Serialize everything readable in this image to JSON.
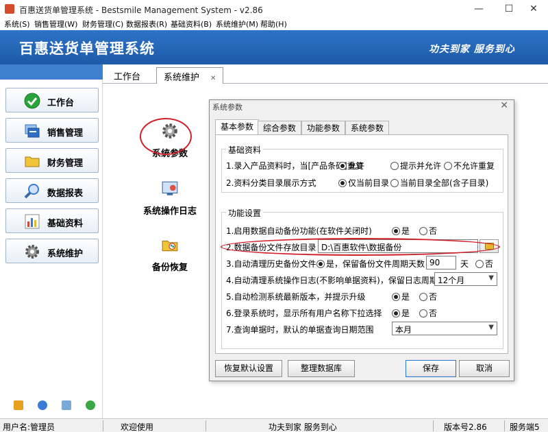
{
  "window": {
    "title": "百惠送货单管理系统 - Bestsmile Management System - v2.86",
    "minimize": "—",
    "maximize": "☐",
    "close": "✕"
  },
  "menu": [
    "系统(S)",
    "销售管理(W)",
    "财务管理(C)",
    "数据报表(R)",
    "基础资料(B)",
    "系统维护(M)",
    "帮助(H)"
  ],
  "banner": {
    "brand": "百惠送货单管理系统",
    "slogan": "功夫到家 服务到心"
  },
  "sidebar": {
    "items": [
      {
        "label": "工作台",
        "icon": "check-circle-icon",
        "color": "#2aa33a"
      },
      {
        "label": "销售管理",
        "icon": "windows-icon",
        "color": "#2e6fc4"
      },
      {
        "label": "财务管理",
        "icon": "folder-icon",
        "color": "#e8b830"
      },
      {
        "label": "数据报表",
        "icon": "magnifier-icon",
        "color": "#3a7bd5"
      },
      {
        "label": "基础资料",
        "icon": "chart-icon",
        "color": "#d8443a"
      },
      {
        "label": "系统维护",
        "icon": "gear-icon",
        "color": "#7a7a7a"
      }
    ],
    "tools": [
      "key-icon",
      "clock-icon",
      "monitor-icon",
      "back-arrow-icon"
    ]
  },
  "tabs": {
    "items": [
      {
        "label": "工作台"
      },
      {
        "label": "系统维护",
        "close": "✕"
      }
    ]
  },
  "workspace": {
    "launchers": [
      {
        "label": "系统参数",
        "icon": "gear-icon"
      },
      {
        "label": "系统操作日志",
        "icon": "log-monitor-icon"
      },
      {
        "label": "备份恢复",
        "icon": "palette-icon"
      }
    ]
  },
  "dialog": {
    "title": "系统参数",
    "close": "✕",
    "tabs": [
      "基本参数",
      "综合参数",
      "功能参数",
      "系统参数"
    ],
    "group_basic": {
      "title": "基础资料",
      "rows": [
        {
          "label": "1.录入产品资料时，当[产品条码]重复",
          "options": [
            "允许",
            "提示并允许",
            "不允许重复"
          ],
          "selected": 0
        },
        {
          "label": "2.资料分类目录展示方式",
          "options": [
            "仅当前目录",
            "当前目录全部(含子目录)"
          ],
          "selected": 0
        }
      ]
    },
    "group_func": {
      "title": "功能设置",
      "row1": {
        "label": "1.启用数据自动备份功能(在软件关闭时)",
        "yes": "是",
        "no": "否",
        "selected": "yes"
      },
      "row2": {
        "label": "2.数据备份文件存放目录",
        "path": "D:\\百惠软件\\数据备份"
      },
      "row3": {
        "label": "3.自动清理历史备份文件",
        "yes_text": "是，保留备份文件周期天数",
        "days": "90",
        "unit": "天",
        "no": "否",
        "selected": "yes"
      },
      "row4": {
        "label": "4.自动清理系统操作日志(不影响单据资料)，保留日志周期",
        "period": "12个月"
      },
      "row5": {
        "label": "5.自动检测系统最新版本，并提示升级",
        "yes": "是",
        "no": "否",
        "selected": "yes"
      },
      "row6": {
        "label": "6.登录系统时，显示所有用户名称下拉选择",
        "yes": "是",
        "no": "否",
        "selected": "yes"
      },
      "row7": {
        "label": "7.查询单据时，默认的单据查询日期范围",
        "range": "本月"
      }
    },
    "buttons": {
      "restore": "恢复默认设置",
      "tidy": "整理数据库",
      "save": "保存",
      "cancel": "取消"
    }
  },
  "status": {
    "user": "用户名:管理员",
    "welcome": "欢迎使用",
    "slogan": "功夫到家 服务到心",
    "version": "版本号2.86",
    "service": "服务端5"
  },
  "colors": {
    "banner": "#2f73c6",
    "highlight": "#d31f2a",
    "accent": "#2a74c8"
  }
}
